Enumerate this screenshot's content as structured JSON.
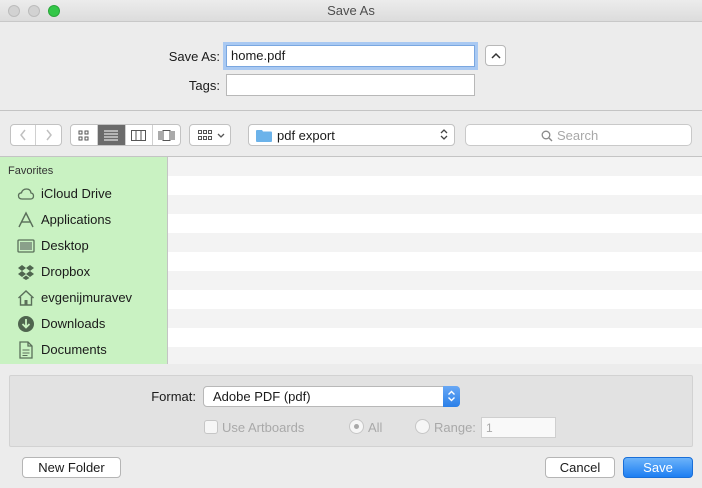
{
  "window": {
    "title": "Save As"
  },
  "form": {
    "save_as_label": "Save As:",
    "filename": "home.pdf",
    "tags_label": "Tags:",
    "tags_value": ""
  },
  "toolbar": {
    "location": "pdf export",
    "search_placeholder": "Search",
    "view_mode": "list"
  },
  "sidebar": {
    "heading": "Favorites",
    "items": [
      {
        "label": "iCloud Drive",
        "icon": "cloud-icon"
      },
      {
        "label": "Applications",
        "icon": "applications-icon"
      },
      {
        "label": "Desktop",
        "icon": "desktop-icon"
      },
      {
        "label": "Dropbox",
        "icon": "dropbox-icon"
      },
      {
        "label": "evgenijmuravev",
        "icon": "home-icon"
      },
      {
        "label": "Downloads",
        "icon": "downloads-icon"
      },
      {
        "label": "Documents",
        "icon": "documents-icon"
      }
    ]
  },
  "options": {
    "format_label": "Format:",
    "format_value": "Adobe PDF (pdf)",
    "use_artboards_label": "Use Artboards",
    "all_label": "All",
    "range_label": "Range:",
    "range_value": "1"
  },
  "buttons": {
    "new_folder": "New Folder",
    "cancel": "Cancel",
    "save": "Save"
  },
  "colors": {
    "sidebar_bg": "#c9f2c2",
    "accent": "#1d7ef2",
    "focus_ring": "#a9c9f2"
  }
}
